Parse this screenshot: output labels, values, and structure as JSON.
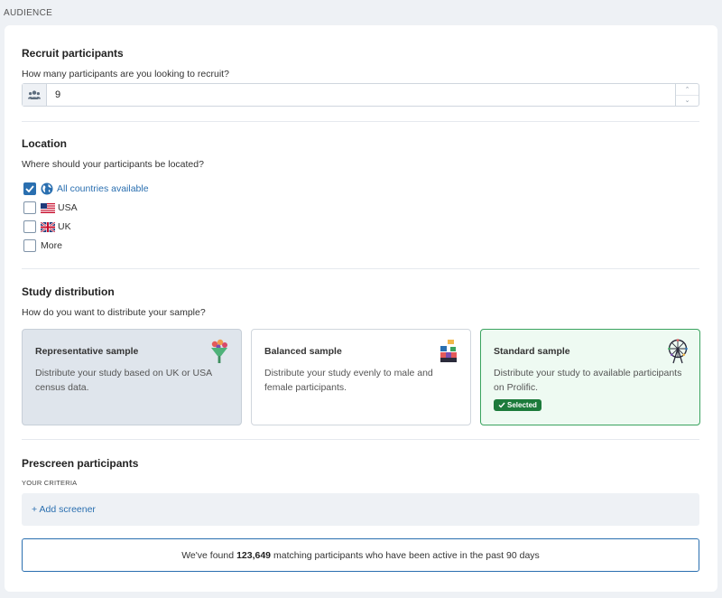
{
  "section_label": "AUDIENCE",
  "recruit": {
    "title": "Recruit participants",
    "question": "How many participants are you looking to recruit?",
    "value": "9",
    "prefix_icon": "users-icon",
    "step_up_icon": "chevron-up-icon",
    "step_down_icon": "chevron-down-icon"
  },
  "location": {
    "title": "Location",
    "question": "Where should your participants be located?",
    "options": [
      {
        "label": "All countries available",
        "checked": true,
        "icon": "globe-icon"
      },
      {
        "label": "USA",
        "checked": false,
        "icon": "usa-flag-icon"
      },
      {
        "label": "UK",
        "checked": false,
        "icon": "uk-flag-icon"
      },
      {
        "label": "More",
        "checked": false
      }
    ]
  },
  "distribution": {
    "title": "Study distribution",
    "question": "How do you want to distribute your sample?",
    "cards": [
      {
        "title": "Representative sample",
        "desc": "Distribute your study based on UK or USA census data.",
        "icon": "bouquet-icon"
      },
      {
        "title": "Balanced sample",
        "desc": "Distribute your study evenly to male and female participants.",
        "icon": "blocks-icon"
      },
      {
        "title": "Standard sample",
        "desc": "Distribute your study to available participants on Prolific.",
        "icon": "ferris-wheel-icon",
        "badge": "Selected"
      }
    ]
  },
  "prescreen": {
    "title": "Prescreen participants",
    "criteria_label": "YOUR CRITERIA",
    "add_label": "+ Add screener"
  },
  "found": {
    "prefix": "We've found",
    "count": "123,649",
    "suffix": "matching participants who have been active in the past 90 days"
  },
  "colors": {
    "accent": "#2a6fb0",
    "selected_green": "#1c7a3b",
    "selected_bg": "#eefaf2"
  }
}
